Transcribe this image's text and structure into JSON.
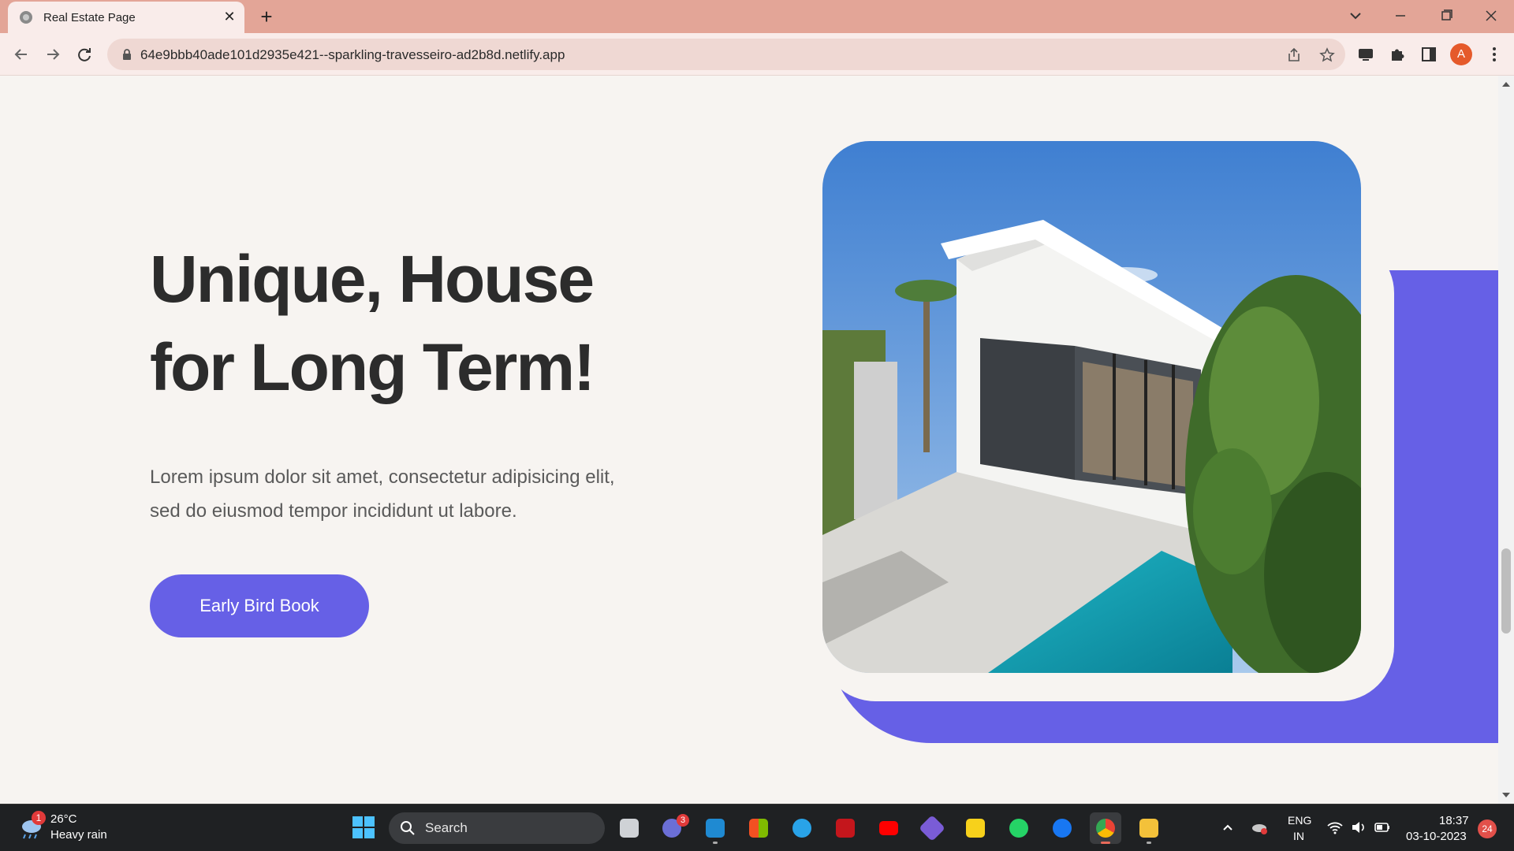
{
  "browser": {
    "tab_title": "Real Estate Page",
    "url": "64e9bbb40ade101d2935e421--sparkling-travesseiro-ad2b8d.netlify.app",
    "profile_initial": "A"
  },
  "hero": {
    "title_line1": "Unique, House",
    "title_line2": "for Long Term!",
    "desc_line1": "Lorem ipsum dolor sit amet, consectetur adipisicing elit,",
    "desc_line2": "sed do eiusmod tempor incididunt ut labore.",
    "cta_label": "Early Bird Book"
  },
  "colors": {
    "accent": "#6660e6",
    "page_bg": "#f7f4f1",
    "tabbar": "#e3a597"
  },
  "taskbar": {
    "weather_badge": "1",
    "weather_temp": "26°C",
    "weather_cond": "Heavy rain",
    "search_label": "Search",
    "teams_badge": "3",
    "lang_line1": "ENG",
    "lang_line2": "IN",
    "time": "18:37",
    "date": "03-10-2023",
    "notifications": "24"
  }
}
